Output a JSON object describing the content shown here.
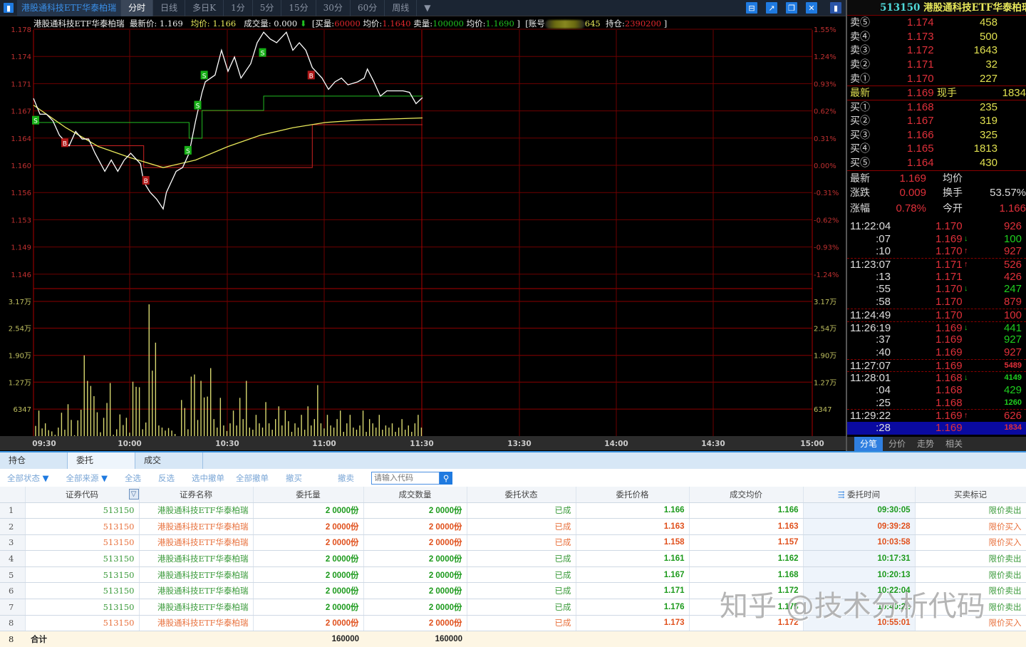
{
  "toolbar": {
    "title": "港股通科技ETF华泰柏瑞",
    "periods": [
      "分时",
      "日线",
      "多日K",
      "1分",
      "5分",
      "15分",
      "30分",
      "60分",
      "周线"
    ],
    "active_period": "分时"
  },
  "info": {
    "name": "港股通科技ETF华泰柏瑞",
    "last_label": "最新价:",
    "last": "1.169",
    "avg_label": "均价:",
    "avg": "1.166",
    "volume_label": "成交量:",
    "volume": "0.000",
    "buy_qty_label": "[买量:",
    "buy_qty": "60000",
    "buy_avg_label": "均价:",
    "buy_avg": "1.1640",
    "sell_qty_label": "卖量:",
    "sell_qty": "100000",
    "sell_avg_label": "均价:",
    "sell_avg": "1.1690",
    "close1": "]",
    "account_label": "[账号",
    "account_suffix": "645",
    "position_label": "持仓:",
    "position": "2390200",
    "close2": "]"
  },
  "chart_data": {
    "type": "line",
    "price_ticks": [
      "1.178",
      "1.174",
      "1.171",
      "1.167",
      "1.164",
      "1.160",
      "1.156",
      "1.153",
      "1.149",
      "1.146"
    ],
    "pct_ticks": [
      "1.55%",
      "1.24%",
      "0.93%",
      "0.62%",
      "0.31%",
      "0.00%",
      "-0.31%",
      "-0.62%",
      "-0.93%",
      "-1.24%"
    ],
    "volume_ticks": [
      {
        "label": "3.17万",
        "value": 31700
      },
      {
        "label": "2.54万",
        "value": 25400
      },
      {
        "label": "1.90万",
        "value": 19000
      },
      {
        "label": "1.27万",
        "value": 12700
      },
      {
        "label": "6347",
        "value": 6347
      }
    ],
    "time_ticks": [
      "09:30",
      "10:00",
      "10:30",
      "11:00",
      "11:30",
      "13:30",
      "14:00",
      "14:30",
      "15:00"
    ],
    "prev_close": 1.16,
    "price": [
      [
        0,
        1.1689
      ],
      [
        2,
        1.1668
      ],
      [
        4,
        1.1668
      ],
      [
        6,
        1.1659
      ],
      [
        8,
        1.164
      ],
      [
        11,
        1.1626
      ],
      [
        13,
        1.1645
      ],
      [
        15,
        1.1635
      ],
      [
        17,
        1.1635
      ],
      [
        19,
        1.1616
      ],
      [
        22,
        1.1592
      ],
      [
        24,
        1.1607
      ],
      [
        26,
        1.1592
      ],
      [
        28,
        1.1607
      ],
      [
        30,
        1.1616
      ],
      [
        33,
        1.1602
      ],
      [
        34,
        1.1578
      ],
      [
        36,
        1.1564
      ],
      [
        38,
        1.1555
      ],
      [
        40,
        1.1542
      ],
      [
        41,
        1.1564
      ],
      [
        44,
        1.1592
      ],
      [
        46,
        1.1597
      ],
      [
        48,
        1.1616
      ],
      [
        50,
        1.1659
      ],
      [
        52,
        1.1697
      ],
      [
        53,
        1.1711
      ],
      [
        56,
        1.172
      ],
      [
        58,
        1.1753
      ],
      [
        60,
        1.1725
      ],
      [
        62,
        1.1744
      ],
      [
        64,
        1.1716
      ],
      [
        67,
        1.1735
      ],
      [
        69,
        1.1763
      ],
      [
        71,
        1.1777
      ],
      [
        73,
        1.1768
      ],
      [
        75,
        1.1763
      ],
      [
        78,
        1.1777
      ],
      [
        80,
        1.1753
      ],
      [
        82,
        1.1763
      ],
      [
        84,
        1.1753
      ],
      [
        86,
        1.173
      ],
      [
        89,
        1.1716
      ],
      [
        91,
        1.1701
      ],
      [
        93,
        1.1711
      ],
      [
        95,
        1.1716
      ],
      [
        97,
        1.1707
      ],
      [
        100,
        1.1711
      ],
      [
        102,
        1.1716
      ],
      [
        103,
        1.1728
      ],
      [
        105,
        1.1711
      ],
      [
        107,
        1.1692
      ],
      [
        109,
        1.1699
      ],
      [
        112,
        1.1699
      ],
      [
        114,
        1.1699
      ],
      [
        116,
        1.1697
      ],
      [
        118,
        1.1682
      ],
      [
        120,
        1.169
      ]
    ],
    "avg_price": [
      [
        0,
        1.168
      ],
      [
        10,
        1.165
      ],
      [
        20,
        1.1625
      ],
      [
        30,
        1.161
      ],
      [
        40,
        1.1597
      ],
      [
        50,
        1.1607
      ],
      [
        60,
        1.1625
      ],
      [
        70,
        1.164
      ],
      [
        80,
        1.165
      ],
      [
        90,
        1.1657
      ],
      [
        100,
        1.166
      ],
      [
        120,
        1.1663
      ]
    ],
    "sell_avg_line": [
      [
        1,
        1.1657
      ],
      [
        48,
        1.1657
      ],
      [
        48,
        1.1636
      ],
      [
        52,
        1.1636
      ],
      [
        52,
        1.1673
      ],
      [
        71,
        1.1673
      ],
      [
        71,
        1.1692
      ],
      [
        120,
        1.1692
      ]
    ],
    "buy_avg_line": [
      [
        10,
        1.1626
      ],
      [
        34,
        1.1626
      ],
      [
        34,
        1.1597
      ],
      [
        86,
        1.1597
      ],
      [
        86,
        1.1654
      ],
      [
        120,
        1.1654
      ]
    ],
    "markers": [
      {
        "type": "S",
        "minute": 0,
        "price": 1.166
      },
      {
        "type": "B",
        "minute": 9,
        "price": 1.163
      },
      {
        "type": "B",
        "minute": 34,
        "price": 1.158
      },
      {
        "type": "S",
        "minute": 47,
        "price": 1.162
      },
      {
        "type": "S",
        "minute": 50,
        "price": 1.168
      },
      {
        "type": "S",
        "minute": 52,
        "price": 1.172
      },
      {
        "type": "S",
        "minute": 70,
        "price": 1.175
      },
      {
        "type": "B",
        "minute": 85,
        "price": 1.172
      }
    ],
    "volume": [
      2400,
      6000,
      1800,
      3000,
      1400,
      1100,
      300,
      2000,
      5500,
      1500,
      7500,
      3800,
      200,
      3700,
      6200,
      19000,
      13000,
      11800,
      9400,
      5600,
      900,
      4300,
      7800,
      12500,
      300,
      1600,
      5100,
      2600,
      4300,
      800,
      12800,
      11600,
      11500,
      1600,
      3200,
      31000,
      15400,
      22000,
      2500,
      2000,
      1300,
      1900,
      1300,
      500,
      0,
      8500,
      6600,
      1600,
      14000,
      14500,
      3800,
      13000,
      9100,
      9300,
      16000,
      4000,
      2000,
      9000,
      2500,
      1200,
      3000,
      6000,
      2500,
      9000,
      4000,
      13000,
      2000,
      1500,
      5000,
      3000,
      2000,
      8000,
      3000,
      1500,
      4000,
      7000,
      2500,
      6000,
      3500,
      1000,
      3000,
      2000,
      5000,
      1500,
      7000,
      2500,
      4000,
      12000,
      3000,
      1800,
      5000,
      2500,
      2000,
      4000,
      6000,
      1000,
      3000,
      5000,
      2000,
      1500,
      2500,
      6000,
      1000,
      4000,
      3000,
      2000,
      5000,
      1500,
      2500,
      2000,
      3000,
      1000,
      2000,
      4000,
      1500,
      2500,
      1000,
      3000,
      5000,
      2000
    ]
  },
  "quote": {
    "header_code": "513150",
    "header_name": "港股通科技ETF华泰柏瑞",
    "asks": [
      {
        "label": "卖⑤",
        "price": "1.174",
        "vol": "458"
      },
      {
        "label": "卖④",
        "price": "1.173",
        "vol": "500"
      },
      {
        "label": "卖③",
        "price": "1.172",
        "vol": "1643"
      },
      {
        "label": "卖②",
        "price": "1.171",
        "vol": "32"
      },
      {
        "label": "卖①",
        "price": "1.170",
        "vol": "227"
      }
    ],
    "last": {
      "label": "最新",
      "price": "1.169",
      "cur_label": "现手",
      "cur_vol": "1834"
    },
    "bids": [
      {
        "label": "买①",
        "price": "1.168",
        "vol": "235"
      },
      {
        "label": "买②",
        "price": "1.167",
        "vol": "319"
      },
      {
        "label": "买③",
        "price": "1.166",
        "vol": "325"
      },
      {
        "label": "买④",
        "price": "1.165",
        "vol": "1813"
      },
      {
        "label": "买⑤",
        "price": "1.164",
        "vol": "430"
      }
    ],
    "stats": [
      {
        "l1": "最新",
        "v1": "1.169",
        "l2": "均价",
        "v2": ""
      },
      {
        "l1": "涨跌",
        "v1": "0.009",
        "l2": "换手",
        "v2": "53.57%"
      },
      {
        "l1": "涨幅",
        "v1": "0.78%",
        "l2": "今开",
        "v2": "1.166"
      }
    ]
  },
  "ticks": [
    {
      "time": "11:22:04",
      "price": "1.170",
      "arrow": "",
      "vol": "926",
      "dir": "up"
    },
    {
      "time": ":07",
      "price": "1.169",
      "arrow": "↓",
      "vol": "100",
      "dir": "down"
    },
    {
      "time": ":10",
      "price": "1.170",
      "arrow": "↑",
      "vol": "927",
      "dir": "up"
    },
    {
      "time": "11:23:07",
      "price": "1.171",
      "arrow": "↑",
      "vol": "526",
      "dir": "up"
    },
    {
      "time": ":13",
      "price": "1.171",
      "arrow": "",
      "vol": "426",
      "dir": "up"
    },
    {
      "time": ":55",
      "price": "1.170",
      "arrow": "↓",
      "vol": "247",
      "dir": "down"
    },
    {
      "time": ":58",
      "price": "1.170",
      "arrow": "",
      "vol": "879",
      "dir": "up"
    },
    {
      "time": "11:24:49",
      "price": "1.170",
      "arrow": "",
      "vol": "100",
      "dir": "up"
    },
    {
      "time": "11:26:19",
      "price": "1.169",
      "arrow": "↓",
      "vol": "441",
      "dir": "down"
    },
    {
      "time": ":37",
      "price": "1.169",
      "arrow": "",
      "vol": "927",
      "dir": "down"
    },
    {
      "time": ":40",
      "price": "1.169",
      "arrow": "",
      "vol": "927",
      "dir": "up"
    },
    {
      "time": "11:27:07",
      "price": "1.169",
      "arrow": "",
      "vol": "5489",
      "dir": "up"
    },
    {
      "time": "11:28:01",
      "price": "1.168",
      "arrow": "↓",
      "vol": "4149",
      "dir": "down"
    },
    {
      "time": ":04",
      "price": "1.168",
      "arrow": "",
      "vol": "429",
      "dir": "down"
    },
    {
      "time": ":25",
      "price": "1.168",
      "arrow": "",
      "vol": "1260",
      "dir": "down"
    },
    {
      "time": "11:29:22",
      "price": "1.169",
      "arrow": "↑",
      "vol": "626",
      "dir": "up"
    },
    {
      "time": ":28",
      "price": "1.169",
      "arrow": "",
      "vol": "1834",
      "dir": "up"
    }
  ],
  "ticks_tabs": [
    "分笔",
    "分价",
    "走势",
    "相关"
  ],
  "orders": {
    "tabs": [
      "持仓",
      "委托",
      "成交"
    ],
    "active_tab": "委托",
    "tools": {
      "status": "全部状态",
      "source": "全部来源",
      "select_all": "全选",
      "invert": "反选",
      "cancel_selected": "选中撤单",
      "cancel_all": "全部撤单",
      "cancel_buy": "撤买",
      "cancel_sell": "撤卖",
      "search_placeholder": "请输入代码"
    },
    "columns": [
      "证券代码",
      "证券名称",
      "委托量",
      "成交数量",
      "委托状态",
      "委托价格",
      "成交均价",
      "委托时间",
      "买卖标记"
    ],
    "rows": [
      {
        "idx": "1",
        "code": "513150",
        "name": "港股通科技ETF华泰柏瑞",
        "qty": "2 0000份",
        "filled": "2 0000份",
        "status": "已成",
        "price": "1.166",
        "avg": "1.166",
        "time": "09:30:05",
        "side": "限价卖出",
        "dir": "sell"
      },
      {
        "idx": "2",
        "code": "513150",
        "name": "港股通科技ETF华泰柏瑞",
        "qty": "2 0000份",
        "filled": "2 0000份",
        "status": "已成",
        "price": "1.163",
        "avg": "1.163",
        "time": "09:39:28",
        "side": "限价买入",
        "dir": "buy"
      },
      {
        "idx": "3",
        "code": "513150",
        "name": "港股通科技ETF华泰柏瑞",
        "qty": "2 0000份",
        "filled": "2 0000份",
        "status": "已成",
        "price": "1.158",
        "avg": "1.157",
        "time": "10:03:58",
        "side": "限价买入",
        "dir": "buy"
      },
      {
        "idx": "4",
        "code": "513150",
        "name": "港股通科技ETF华泰柏瑞",
        "qty": "2 0000份",
        "filled": "2 0000份",
        "status": "已成",
        "price": "1.161",
        "avg": "1.162",
        "time": "10:17:31",
        "side": "限价卖出",
        "dir": "sell"
      },
      {
        "idx": "5",
        "code": "513150",
        "name": "港股通科技ETF华泰柏瑞",
        "qty": "2 0000份",
        "filled": "2 0000份",
        "status": "已成",
        "price": "1.167",
        "avg": "1.168",
        "time": "10:20:13",
        "side": "限价卖出",
        "dir": "sell"
      },
      {
        "idx": "6",
        "code": "513150",
        "name": "港股通科技ETF华泰柏瑞",
        "qty": "2 0000份",
        "filled": "2 0000份",
        "status": "已成",
        "price": "1.171",
        "avg": "1.172",
        "time": "10:22:04",
        "side": "限价卖出",
        "dir": "sell"
      },
      {
        "idx": "7",
        "code": "513150",
        "name": "港股通科技ETF华泰柏瑞",
        "qty": "2 0000份",
        "filled": "2 0000份",
        "status": "已成",
        "price": "1.176",
        "avg": "1.175",
        "time": "10:40:22",
        "side": "限价卖出",
        "dir": "sell"
      },
      {
        "idx": "8",
        "code": "513150",
        "name": "港股通科技ETF华泰柏瑞",
        "qty": "2 0000份",
        "filled": "2 0000份",
        "status": "已成",
        "price": "1.173",
        "avg": "1.172",
        "time": "10:55:01",
        "side": "限价买入",
        "dir": "buy"
      }
    ],
    "total": {
      "idx": "8",
      "label": "合计",
      "qty": "160000",
      "filled": "160000"
    }
  },
  "watermark": "知乎 @技术分析代码",
  "colors": {
    "up": "#e0303a",
    "down": "#1fcf1f",
    "grid": "#6e0000",
    "price_line": "#ffffff",
    "avg_line": "#e8e85a"
  }
}
